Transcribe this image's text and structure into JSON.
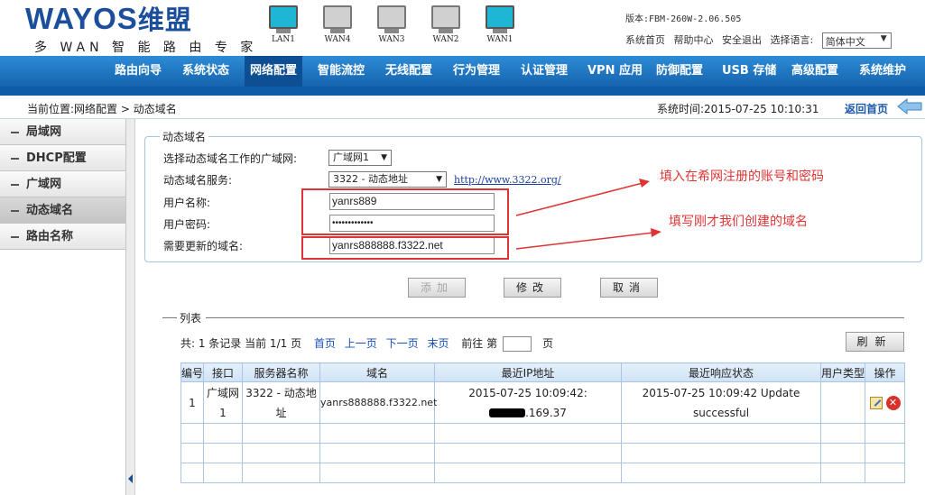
{
  "header": {
    "logo_text": "WAYOS",
    "logo_zh": "维盟",
    "logo_slogan": "多 WAN 智 能 路 由 专 家",
    "ports": [
      {
        "label": "LAN1",
        "active": true
      },
      {
        "label": "WAN4",
        "active": false
      },
      {
        "label": "WAN3",
        "active": false
      },
      {
        "label": "WAN2",
        "active": false
      },
      {
        "label": "WAN1",
        "active": true
      }
    ],
    "version": "版本:FBM-260W-2.06.505",
    "links": [
      "系统首页",
      "帮助中心",
      "安全退出"
    ],
    "lang_label": "选择语言:",
    "lang_value": "简体中文"
  },
  "nav": {
    "items": [
      "路由向导",
      "系统状态",
      "网络配置",
      "智能流控",
      "无线配置",
      "行为管理",
      "认证管理",
      "VPN 应用",
      "防御配置",
      "USB 存储",
      "高级配置",
      "系统维护"
    ],
    "active_index": 2
  },
  "crumb": {
    "location": "当前位置:网络配置 > 动态域名",
    "system_time": "系统时间:2015-07-25 10:10:31",
    "home": "返回首页"
  },
  "sidebar": {
    "items": [
      "局域网",
      "DHCP配置",
      "广域网",
      "动态域名",
      "路由名称"
    ],
    "active_index": 3
  },
  "form": {
    "legend": "动态域名",
    "wan_label": "选择动态域名工作的广域网:",
    "wan_value": "广域网1",
    "service_label": "动态域名服务:",
    "service_value": "3322 - 动态地址",
    "service_link": "http://www.3322.org/",
    "user_label": "用户名称:",
    "user_value": "yanrs889",
    "pass_label": "用户密码:",
    "pass_value": "•••••••••••••",
    "domain_label": "需要更新的域名:",
    "domain_value": "yanrs888888.f3322.net",
    "add_button": "添加",
    "edit_button": "修改",
    "cancel_button": "取消"
  },
  "annotations": {
    "account_note": "填入在希网注册的账号和密码",
    "domain_note": "填写刚才我们创建的域名",
    "color": "#e03434"
  },
  "list": {
    "legend": "列表",
    "summary": "共: 1 条记录 当前 1/1 页",
    "first": "首页",
    "prev": "上一页",
    "next": "下一页",
    "last": "末页",
    "goto_prefix": "前往 第",
    "goto_suffix": "页",
    "refresh": "刷新",
    "columns": [
      "编号",
      "接口",
      "服务器名称",
      "域名",
      "最近IP地址",
      "最近响应状态",
      "用户类型",
      "操作"
    ],
    "rows": [
      {
        "no": "1",
        "iface": "广域网1",
        "server": "3322 - 动态地址",
        "domain": "yanrs888888.f3322.net",
        "ip_time": "2015-07-25 10:09:42:",
        "ip_suffix": ".169.37",
        "status": "2015-07-25 10:09:42 Update successful",
        "user_type": ""
      }
    ]
  }
}
